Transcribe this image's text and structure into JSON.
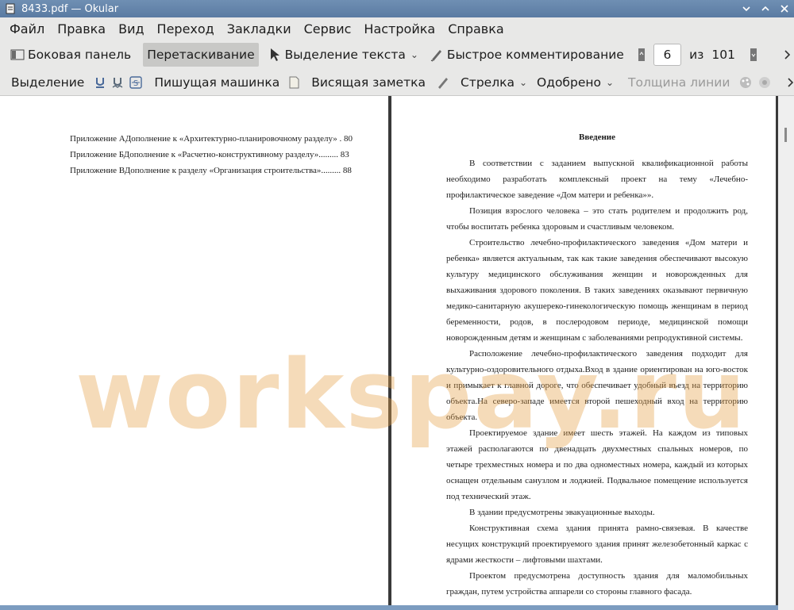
{
  "window": {
    "title": "8433.pdf  — Okular"
  },
  "menu": [
    "Файл",
    "Правка",
    "Вид",
    "Переход",
    "Закладки",
    "Сервис",
    "Настройка",
    "Справка"
  ],
  "toolbar": {
    "sidebar": "Боковая панель",
    "drag": "Перетаскивание",
    "text_select": "Выделение текста",
    "quick_annot": "Быстрое комментирование",
    "page_value": "6",
    "page_of": "из",
    "page_total": "101"
  },
  "annot_toolbar": {
    "highlight": "Выделение",
    "typewriter": "Пишущая машинка",
    "popup_note": "Висящая заметка",
    "arrow": "Стрелка",
    "stamp": "Одобрено",
    "line_width": "Толщина линии"
  },
  "left_page": {
    "toc": [
      "Приложение АДополнение к «Архитектурно-планировочному разделу» . 80",
      "Приложение БДополнение к «Расчетно-конструктивному разделу»......... 83",
      "Приложение ВДополнение к разделу «Организация строительства»......... 88"
    ]
  },
  "right_page": {
    "heading": "Введение",
    "paragraphs": [
      "В соответствии с заданием выпускной квалификационной работы необходимо разработать комплексный проект на тему «Лечебно-профилактическое заведение «Дом матери и ребенка»».",
      "Позиция взрослого человека – это стать родителем и продолжить род, чтобы воспитать ребенка здоровым и счастливым человеком.",
      "Строительство лечебно-профилактического заведения «Дом матери и ребенка» является актуальным, так как такие заведения обеспечивают высокую культуру медицинского обслуживания женщин и новорожденных для выхаживания здорового поколения. В таких заведениях оказывают первичную медико-санитарную акушереко-гинекологическую помощь женщинам в период беременности, родов, в послеродовом периоде, медицинской помощи новорожденным детям и женщинам с заболеваниями репродуктивной системы.",
      "Расположение лечебно-профилактического заведения подходит для культурно-оздоровительного отдыха.Вход в здание ориентирован на юго-восток и примыкает к главной дороге, что обеспечивает удобный въезд на территорию объекта.На северо-западе имеется второй пешеходный вход на территорию объекта.",
      "Проектируемое здание имеет шесть этажей. На каждом из типовых этажей располагаются по двенадцать двухместных спальных номеров, по четыре трехместных номера и по два одноместных номера, каждый из которых оснащен отдельным санузлом и лоджией. Подвальное помещение используется под технический этаж.",
      "В здании предусмотрены эвакуационные выходы.",
      "Конструктивная схема здания принята рамно-связевая. В качестве несущих конструкций проектируемого здания принят железобетонный каркас с ядрами жесткости – лифтовыми шахтами.",
      "Проектом предусмотрена доступность здания для маломобильных граждан, путем устройства аппарели со стороны главного фасада."
    ]
  },
  "watermark": "workspay.ru"
}
